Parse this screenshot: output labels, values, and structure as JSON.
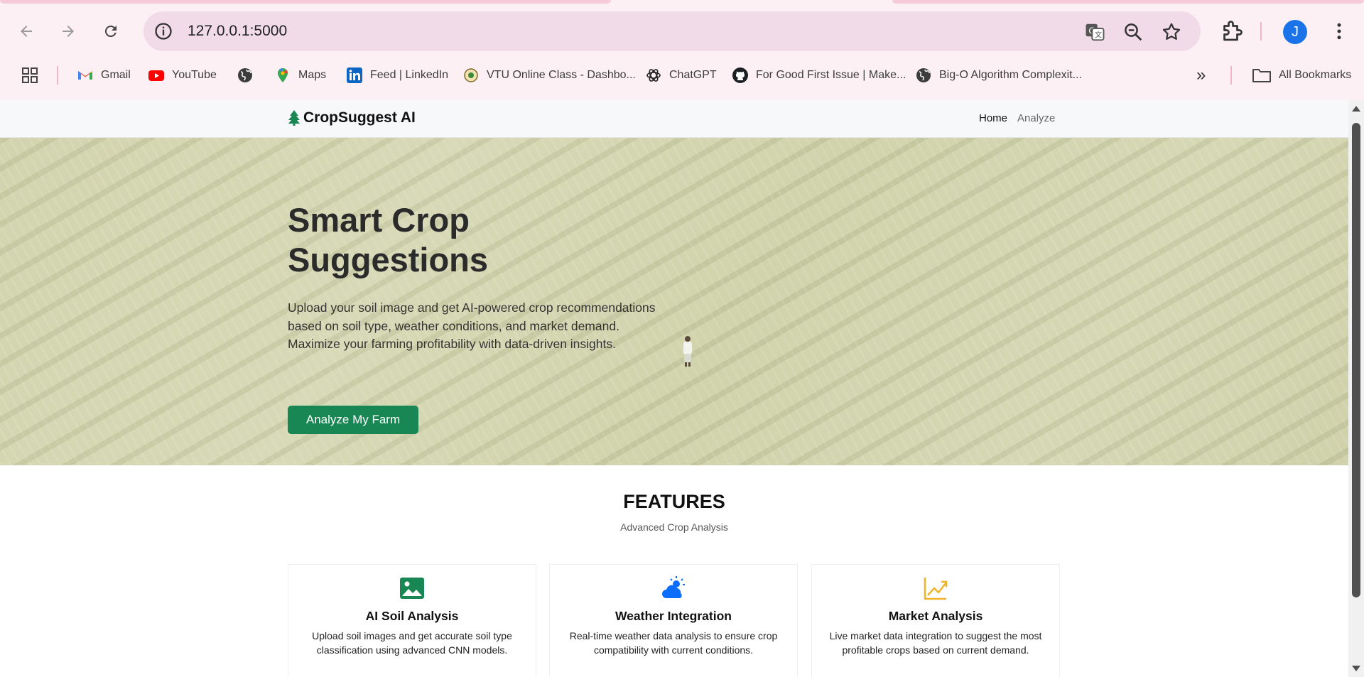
{
  "browser": {
    "url": "127.0.0.1:5000",
    "profile_initial": "J",
    "bookmarks": [
      {
        "label": "Gmail",
        "icon": "gmail-icon"
      },
      {
        "label": "YouTube",
        "icon": "youtube-icon"
      },
      {
        "label": "",
        "icon": "globe-icon"
      },
      {
        "label": "Maps",
        "icon": "maps-icon"
      },
      {
        "label": "Feed | LinkedIn",
        "icon": "linkedin-icon"
      },
      {
        "label": "VTU Online Class - Dashbo...",
        "icon": "vtu-icon"
      },
      {
        "label": "ChatGPT",
        "icon": "chatgpt-icon"
      },
      {
        "label": "For Good First Issue | Make...",
        "icon": "github-icon"
      },
      {
        "label": "Big-O Algorithm Complexit...",
        "icon": "globe-icon"
      }
    ],
    "all_bookmarks": "All Bookmarks",
    "overflow_chevron": "»"
  },
  "site": {
    "brand": "CropSuggest AI",
    "nav": [
      {
        "label": "Home",
        "active": true
      },
      {
        "label": "Analyze",
        "active": false
      }
    ]
  },
  "hero": {
    "title": "Smart Crop Suggestions",
    "description": "Upload your soil image and get AI-powered crop recommendations based on soil type, weather conditions, and market demand. Maximize your farming profitability with data-driven insights.",
    "cta": "Analyze My Farm"
  },
  "features": {
    "title": "FEATURES",
    "subtitle": "Advanced Crop Analysis",
    "cards": [
      {
        "title": "AI Soil Analysis",
        "description": "Upload soil images and get accurate soil type classification using advanced CNN models.",
        "icon": "image-icon",
        "color": "#198754"
      },
      {
        "title": "Weather Integration",
        "description": "Real-time weather data analysis to ensure crop compatibility with current conditions.",
        "icon": "cloud-sun-icon",
        "color": "#0d6efd"
      },
      {
        "title": "Market Analysis",
        "description": "Live market data integration to suggest the most profitable crops based on current demand.",
        "icon": "chart-line-icon",
        "color": "#f0b429"
      }
    ]
  },
  "colors": {
    "primary_green": "#198754",
    "chrome_bg": "#fdf0f4",
    "omnibox_bg": "#f2dbe8"
  }
}
